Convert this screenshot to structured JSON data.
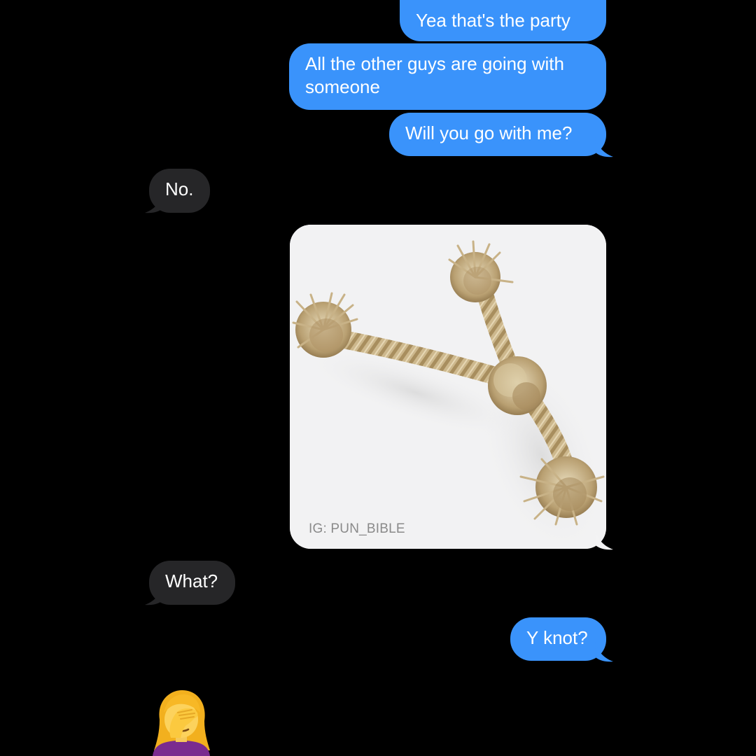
{
  "messages": [
    {
      "id": "b1",
      "from": "me",
      "text": "Yea that's the party"
    },
    {
      "id": "b2",
      "from": "me",
      "text": "All the other guys are going with someone"
    },
    {
      "id": "b3",
      "from": "me",
      "text": "Will you go with me?"
    },
    {
      "id": "r1",
      "from": "them",
      "text": "No."
    },
    {
      "id": "img",
      "from": "me",
      "type": "image",
      "image_subject": "rope tied in the shape of a letter Y with knotted ends",
      "watermark": "IG: PUN_BIBLE"
    },
    {
      "id": "r2",
      "from": "them",
      "text": "What?"
    },
    {
      "id": "b4",
      "from": "me",
      "text": "Y knot?"
    },
    {
      "id": "emoji",
      "from": "them",
      "type": "emoji",
      "emoji": "🤦‍♀️",
      "icon": "woman-facepalming-emoji"
    }
  ],
  "colors": {
    "background": "#000000",
    "sent_bubble": "#3a93fb",
    "received_bubble": "#262628",
    "text": "#ffffff"
  }
}
